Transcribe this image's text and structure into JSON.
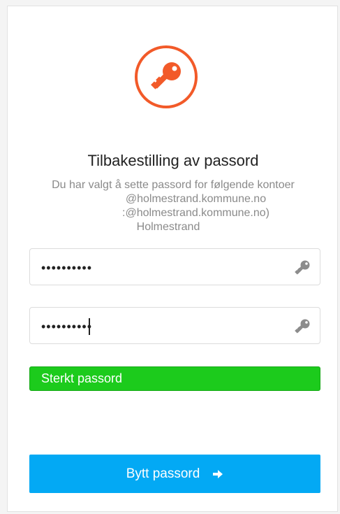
{
  "page": {
    "title": "Tilbakestilling av passord",
    "info_lines": [
      "Du har valgt å sette passord for følgende kontoer",
      "@holmestrand.kommune.no",
      ":@holmestrand.kommune.no)",
      "Holmestrand"
    ]
  },
  "fields": {
    "password_value": "••••••••••",
    "confirm_value": "••••••••••"
  },
  "strength": {
    "label": "Sterkt passord"
  },
  "submit": {
    "label": "Bytt passord"
  },
  "colors": {
    "accent_orange": "#f25a29",
    "strength_green": "#1ccb1c",
    "button_blue": "#03a9f4"
  },
  "icons": {
    "logo": "key-icon",
    "field_icon": "key-icon",
    "button_icon": "arrow-right-icon"
  }
}
